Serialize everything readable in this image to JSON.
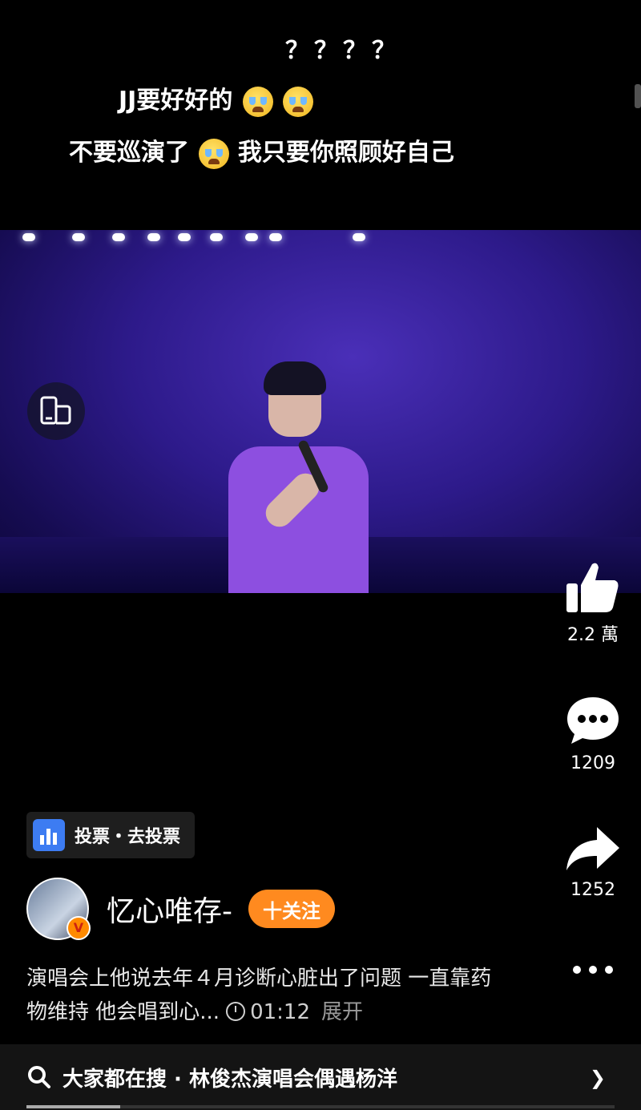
{
  "comments": {
    "line1": "？？？？",
    "line2_text": "JJ要好好的",
    "line3_text_a": "不要巡演了",
    "line3_text_b": "我只要你照顾好自己"
  },
  "video": {
    "rotate_icon": "rotate-screen-icon"
  },
  "actions": {
    "like_count": "2.2 萬",
    "comment_count": "1209",
    "share_count": "1252"
  },
  "poll": {
    "label": "投票・去投票"
  },
  "author": {
    "name": "忆心唯存-",
    "follow_label": "十关注"
  },
  "caption": {
    "text": "演唱会上他说去年４月诊断心脏出了问题 一直靠药物维持 他会唱到心...",
    "duration": "01:12",
    "expand": "展开"
  },
  "search": {
    "text": "大家都在搜 · 林俊杰演唱会偶遇杨洋"
  },
  "progress": {
    "fraction": 0.16
  },
  "colors": {
    "follow": "#ff8a1f",
    "poll_icon": "#3d7cf2"
  }
}
